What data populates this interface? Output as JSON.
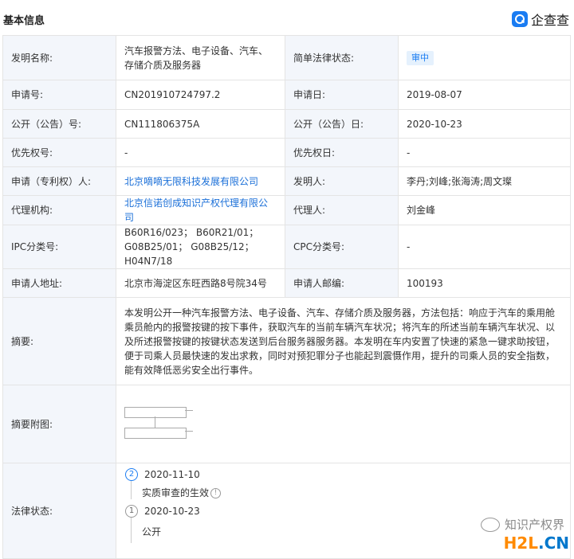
{
  "header": {
    "title": "基本信息",
    "brand": "企查查"
  },
  "rows": {
    "invention_name": {
      "label": "发明名称:",
      "value": "汽车报警方法、电子设备、汽车、存储介质及服务器"
    },
    "legal_status_short": {
      "label": "简单法律状态:",
      "value": "审中"
    },
    "app_no": {
      "label": "申请号:",
      "value": "CN201910724797.2"
    },
    "app_date": {
      "label": "申请日:",
      "value": "2019-08-07"
    },
    "pub_no": {
      "label": "公开（公告）号:",
      "value": "CN111806375A"
    },
    "pub_date": {
      "label": "公开（公告）日:",
      "value": "2020-10-23"
    },
    "priority_no": {
      "label": "优先权号:",
      "value": "-"
    },
    "priority_date": {
      "label": "优先权日:",
      "value": "-"
    },
    "applicant": {
      "label": "申请（专利权）人:",
      "value": "北京嘀嘀无限科技发展有限公司"
    },
    "inventor": {
      "label": "发明人:",
      "value": "李丹;刘峰;张海涛;周文璨"
    },
    "agency": {
      "label": "代理机构:",
      "value": "北京信诺创成知识产权代理有限公司"
    },
    "agent": {
      "label": "代理人:",
      "value": "刘金峰"
    },
    "ipc": {
      "label": "IPC分类号:",
      "value": "B60R16/023； B60R21/01； G08B25/01； G08B25/12； H04N7/18"
    },
    "cpc": {
      "label": "CPC分类号:",
      "value": "-"
    },
    "address": {
      "label": "申请人地址:",
      "value": "北京市海淀区东旺西路8号院34号"
    },
    "postcode": {
      "label": "申请人邮编:",
      "value": "100193"
    },
    "abstract": {
      "label": "摘要:",
      "value": "本发明公开一种汽车报警方法、电子设备、汽车、存储介质及服务器，方法包括：响应于汽车的乘用舱乘员舱内的报警按键的按下事件，获取汽车的当前车辆汽车状况；将汽车的所述当前车辆汽车状况、以及所述报警按键的按键状态发送到后台服务器服务器。本发明在车内安置了快速的紧急一键求助按钮，便于司乘人员最快速的发出求救，同时对预犯罪分子也能起到震慑作用，提升的司乘人员的安全指数，能有效降低恶劣安全出行事件。"
    },
    "abstract_figure": {
      "label": "摘要附图:"
    },
    "legal_status": {
      "label": "法律状态:"
    }
  },
  "timeline": [
    {
      "num": "2",
      "date": "2020-11-10",
      "status": "实质审查的生效"
    },
    {
      "num": "1",
      "date": "2020-10-23",
      "status": "公开"
    }
  ],
  "watermark": {
    "text": "知识产权界",
    "site_h": "H2L",
    "site_dot": ".",
    "site_cn": "CN"
  },
  "colors": {
    "link": "#1a6fd8",
    "label_bg": "#f3f6fb",
    "accent": "#1a7cf2",
    "border": "#e4e4e4"
  },
  "icons": {
    "brand": "qichacha-logo-icon",
    "info": "info-circle-icon",
    "wechat": "wechat-icon"
  }
}
